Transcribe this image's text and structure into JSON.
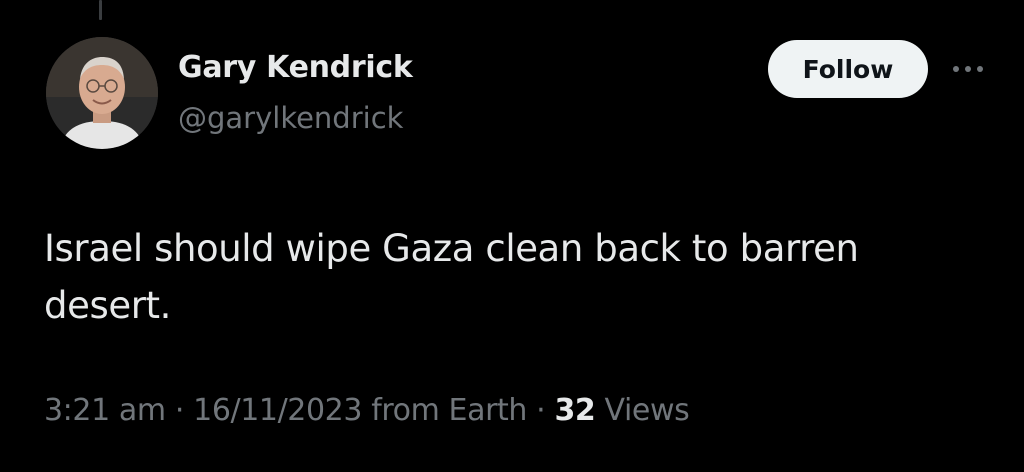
{
  "author": {
    "display_name": "Gary Kendrick",
    "handle": "@garylkendrick"
  },
  "actions": {
    "follow_label": "Follow",
    "more_icon": "more-horizontal-icon"
  },
  "tweet": {
    "text": "Israel should wipe Gaza clean back to barren desert."
  },
  "meta": {
    "time": "3:21 am",
    "separator": "·",
    "date": "16/11/2023",
    "source": "from Earth",
    "views_count": "32",
    "views_label": "Views"
  },
  "colors": {
    "background": "#000000",
    "primary_text": "#e7e9ea",
    "secondary_text": "#71767b",
    "follow_button_bg": "#eff3f4",
    "follow_button_text": "#0f1419"
  }
}
